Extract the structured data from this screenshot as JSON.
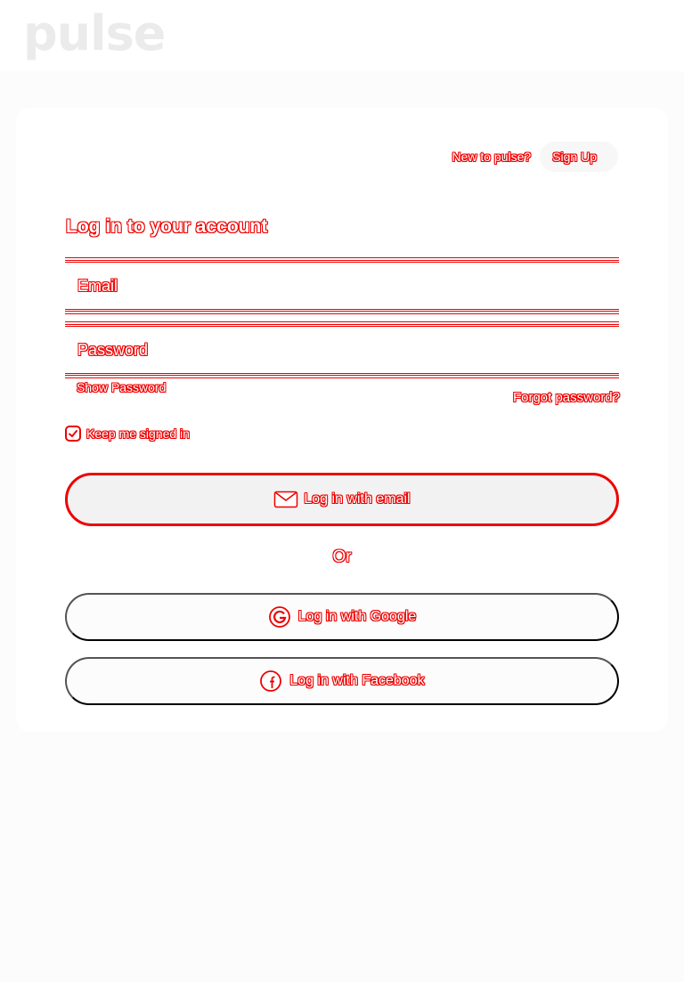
{
  "app": {
    "logo": "pulse"
  },
  "header": {
    "signup_prompt": "New to pulse?",
    "signup_label": "Sign Up"
  },
  "form": {
    "title": "Log in to your account",
    "email_placeholder": "Email",
    "password_placeholder": "Password",
    "show_password": "Show Password",
    "forgot_password": "Forgot password?",
    "keep_signed_in": "Keep me signed in",
    "keep_signed_in_checked": true
  },
  "actions": {
    "email_login": "Log in with email",
    "or": "Or",
    "google_login": "Log in with Google",
    "facebook_login": "Log in with Facebook"
  },
  "colors": {
    "outline": "#ee0000",
    "text_fill": "#ffffff",
    "page_bg": "#fcfcfc",
    "logo": "#ebebeb"
  },
  "icons": [
    "envelope-icon",
    "google-icon",
    "facebook-icon",
    "checkmark-icon"
  ]
}
